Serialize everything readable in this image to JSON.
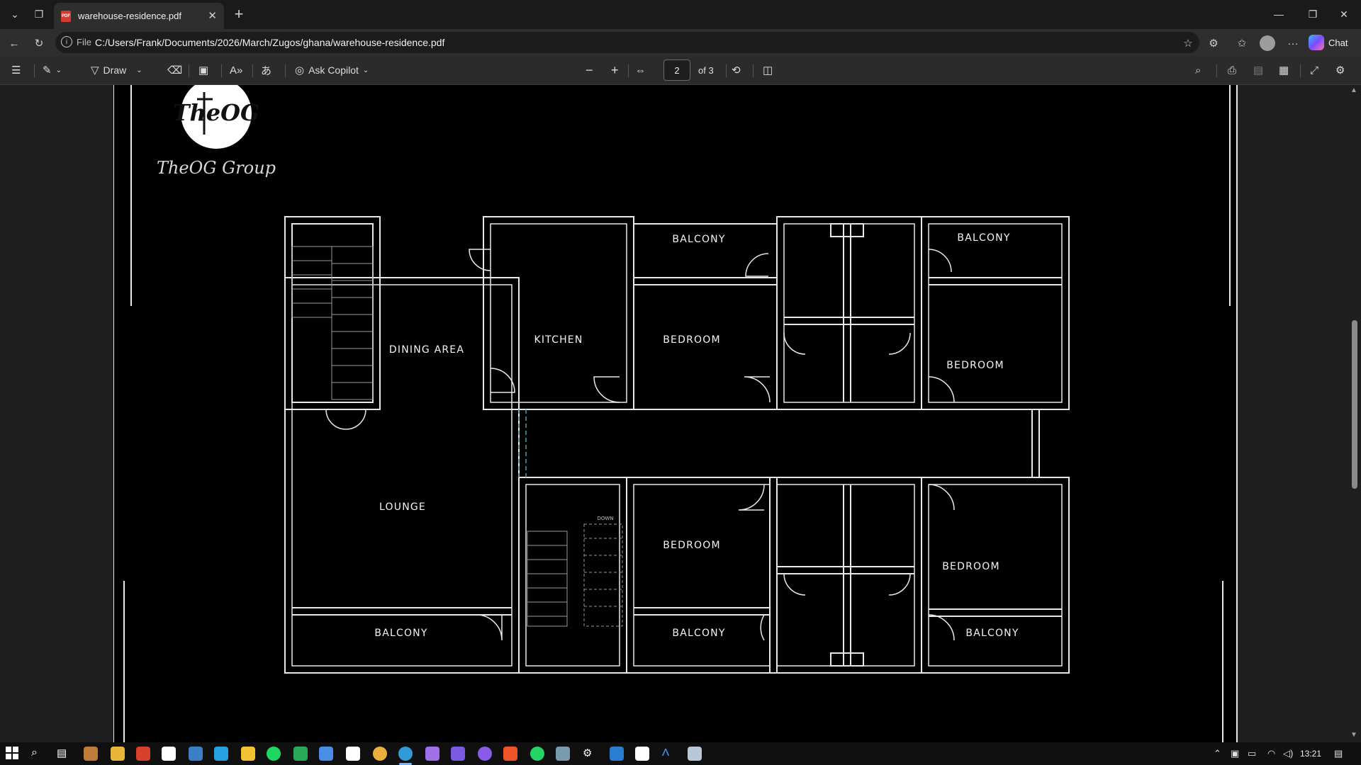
{
  "browser": {
    "tab": {
      "title": "warehouse-residence.pdf",
      "icon": "pdf-icon"
    },
    "address": {
      "scheme_label": "File",
      "url": "C:/Users/Frank/Documents/2026/March/Zugos/ghana/warehouse-residence.pdf"
    },
    "chat_label": "Chat"
  },
  "pdf_toolbar": {
    "draw_label": "Draw",
    "ask_copilot_label": "Ask Copilot",
    "current_page": "2",
    "page_total_label": "of 3"
  },
  "document": {
    "logo_text": "TheOG",
    "brand_script": "TheOG Group",
    "rooms": {
      "dining_area": "DINING AREA",
      "kitchen": "KITCHEN",
      "bedroom": "BEDROOM",
      "balcony": "BALCONY",
      "lounge": "LOUNGE",
      "down": "DOWN"
    }
  },
  "taskbar": {
    "time": "13:21"
  },
  "colors": {
    "page_background": "#000000",
    "drawing_lines": "#e8e8e8",
    "stair_lines": "#9a9a9a",
    "dashed_accent": "#3aa6a6",
    "acrobat_red": "#c8201c"
  }
}
